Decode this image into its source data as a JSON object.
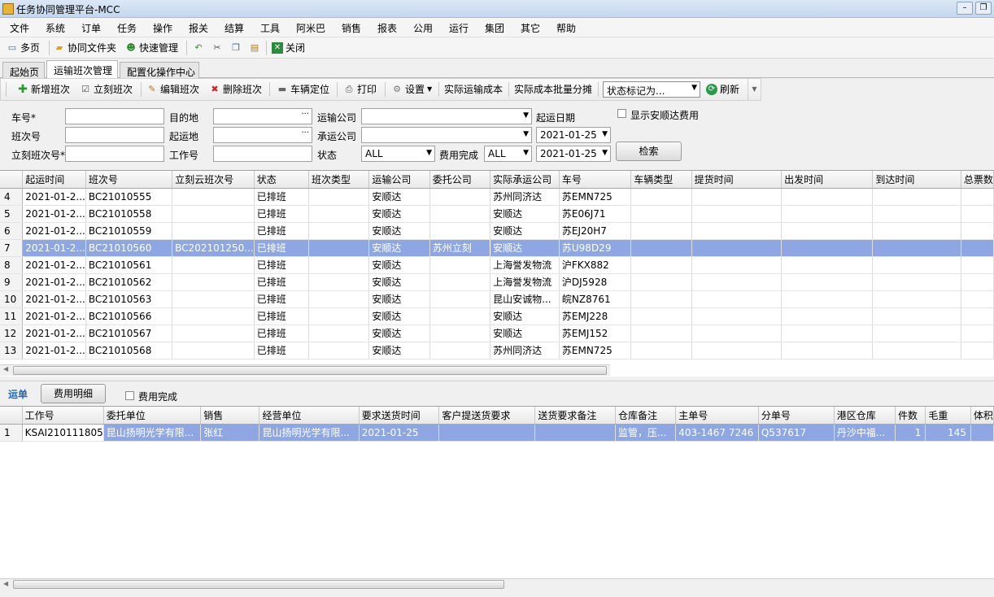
{
  "window": {
    "title": "任务协同管理平台-MCC",
    "minimize": "–",
    "restore": "❐"
  },
  "menu": [
    "文件",
    "系统",
    "订单",
    "任务",
    "操作",
    "报关",
    "结算",
    "工具",
    "阿米巴",
    "销售",
    "报表",
    "公用",
    "运行",
    "集团",
    "其它",
    "帮助"
  ],
  "toolbar1": {
    "multi_page": "多页",
    "shared_folder": "协同文件夹",
    "quick_manage": "快速管理",
    "close": "关闭"
  },
  "tabs": [
    "起始页",
    "运输班次管理",
    "配置化操作中心"
  ],
  "toolbar2": {
    "add": "新增班次",
    "lk": "立刻班次",
    "edit": "编辑班次",
    "del": "删除班次",
    "locate": "车辆定位",
    "print": "打印",
    "settings": "设置",
    "actual_cost": "实际运输成本",
    "batch_split": "实际成本批量分摊",
    "status_mark": "状态标记为...",
    "refresh": "刷新"
  },
  "filters": {
    "plate": "车号*",
    "dest": "目的地",
    "carrier": "运输公司",
    "start_date_label": "起运日期",
    "show_fee": "显示安顺达费用",
    "shift_no": "班次号",
    "origin": "起运地",
    "contractor": "承运公司",
    "date1": "2021-01-25",
    "lk_shift": "立刻班次号*",
    "job_no": "工作号",
    "status_label": "状态",
    "status_value": "ALL",
    "fee_done_label": "费用完成",
    "fee_done_value": "ALL",
    "date2": "2021-01-25",
    "search": "检索",
    "ellipsis": "···"
  },
  "grid1": {
    "columns": [
      "起运时间",
      "班次号",
      "立刻云班次号",
      "状态",
      "班次类型",
      "运输公司",
      "委托公司",
      "实际承运公司",
      "车号",
      "车辆类型",
      "提货时间",
      "出发时间",
      "到达时间",
      "总票数"
    ],
    "rows": [
      {
        "n": "4",
        "t": "2021-01-2...",
        "shift": "BC21010555",
        "lk": "",
        "st": "已排班",
        "type": "",
        "carrier": "安顺达",
        "client": "",
        "actual": "苏州同济达",
        "plate": "苏EMN725"
      },
      {
        "n": "5",
        "t": "2021-01-2...",
        "shift": "BC21010558",
        "lk": "",
        "st": "已排班",
        "type": "",
        "carrier": "安顺达",
        "client": "",
        "actual": "安顺达",
        "plate": "苏E06J71"
      },
      {
        "n": "6",
        "t": "2021-01-2...",
        "shift": "BC21010559",
        "lk": "",
        "st": "已排班",
        "type": "",
        "carrier": "安顺达",
        "client": "",
        "actual": "安顺达",
        "plate": "苏EJ20H7"
      },
      {
        "n": "7",
        "t": "2021-01-2...",
        "shift": "BC21010560",
        "lk": "BC202101250...",
        "st": "已排班",
        "type": "",
        "carrier": "安顺达",
        "client": "苏州立刻",
        "actual": "安顺达",
        "plate": "苏U98D29"
      },
      {
        "n": "8",
        "t": "2021-01-2...",
        "shift": "BC21010561",
        "lk": "",
        "st": "已排班",
        "type": "",
        "carrier": "安顺达",
        "client": "",
        "actual": "上海誉发物流",
        "plate": "沪FKX882"
      },
      {
        "n": "9",
        "t": "2021-01-2...",
        "shift": "BC21010562",
        "lk": "",
        "st": "已排班",
        "type": "",
        "carrier": "安顺达",
        "client": "",
        "actual": "上海誉发物流",
        "plate": "沪DJ5928"
      },
      {
        "n": "10",
        "t": "2021-01-2...",
        "shift": "BC21010563",
        "lk": "",
        "st": "已排班",
        "type": "",
        "carrier": "安顺达",
        "client": "",
        "actual": "昆山安诚物...",
        "plate": "皖NZ8761"
      },
      {
        "n": "11",
        "t": "2021-01-2...",
        "shift": "BC21010566",
        "lk": "",
        "st": "已排班",
        "type": "",
        "carrier": "安顺达",
        "client": "",
        "actual": "安顺达",
        "plate": "苏EMJ228"
      },
      {
        "n": "12",
        "t": "2021-01-2...",
        "shift": "BC21010567",
        "lk": "",
        "st": "已排班",
        "type": "",
        "carrier": "安顺达",
        "client": "",
        "actual": "安顺达",
        "plate": "苏EMJ152"
      },
      {
        "n": "13",
        "t": "2021-01-2...",
        "shift": "BC21010568",
        "lk": "",
        "st": "已排班",
        "type": "",
        "carrier": "安顺达",
        "client": "",
        "actual": "苏州同济达",
        "plate": "苏EMN725"
      }
    ]
  },
  "sub": {
    "waybill": "运单",
    "fee_detail": "费用明细",
    "fee_done": "费用完成"
  },
  "grid2": {
    "columns": [
      "工作号",
      "委托单位",
      "销售",
      "经营单位",
      "要求送货时间",
      "客户提送货要求",
      "送货要求备注",
      "仓库备注",
      "主单号",
      "分单号",
      "港区仓库",
      "件数",
      "毛重",
      "体积"
    ],
    "rows": [
      {
        "n": "1",
        "job": "KSAI210111805",
        "client": "昆山扬明光学有限...",
        "sales": "张红",
        "unit": "昆山扬明光学有限...",
        "time": "2021-01-25",
        "req": "",
        "note": "",
        "wh": "监管，压...",
        "mawb": "403-1467 7246",
        "hawb": "Q537617",
        "port": "丹沙中福...",
        "pcs": "1",
        "gw": "145"
      }
    ]
  }
}
